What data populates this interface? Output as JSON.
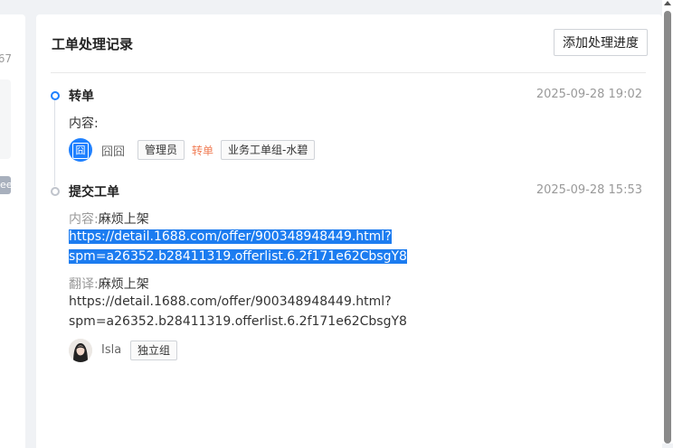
{
  "left_panel": {
    "number": "67",
    "badge": "ee"
  },
  "card": {
    "title": "工单处理记录",
    "add_button": "添加处理进度"
  },
  "events": [
    {
      "title": "转单",
      "time": "2025-09-28 19:02",
      "content_label": "内容:",
      "user": "囧囧",
      "avatar_char": "囧",
      "tag1": "管理员",
      "action": "转单",
      "tag2": "业务工单组-水碧"
    },
    {
      "title": "提交工单",
      "time": "2025-09-28 15:53",
      "content_label": "内容:",
      "content_value": "麻烦上架",
      "content_url_1": "https://detail.1688.com/offer/900348948449.html?",
      "content_url_2": "spm=a26352.b28411319.offerlist.6.2f171e62CbsgY8",
      "translate_label": "翻译:",
      "translate_value": "麻烦上架",
      "translate_url_1": "https://detail.1688.com/offer/900348948449.html?",
      "translate_url_2": "spm=a26352.b28411319.offerlist.6.2f171e62CbsgY8",
      "user": "Isla",
      "tag1": "独立组"
    }
  ]
}
